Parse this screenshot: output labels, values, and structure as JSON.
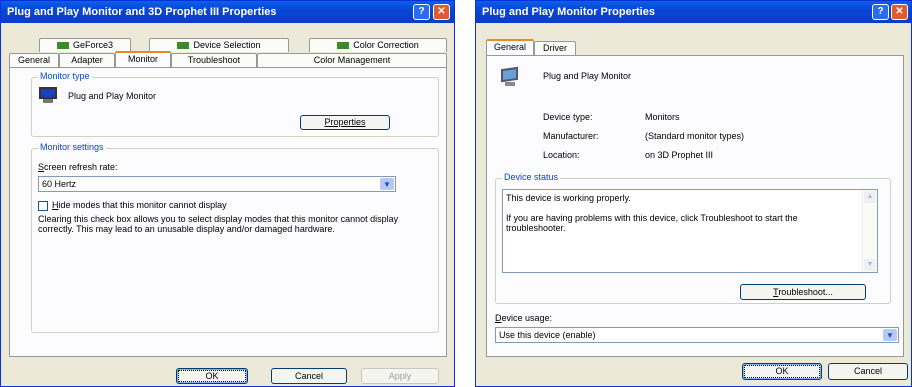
{
  "win1": {
    "title": "Plug and Play Monitor and 3D Prophet III Properties",
    "tabs_top": [
      "GeForce3",
      "Device Selection",
      "Color Correction"
    ],
    "tabs_bottom": [
      "General",
      "Adapter",
      "Monitor",
      "Troubleshoot",
      "Color Management"
    ],
    "active_tab": "Monitor",
    "monitor_type_label": "Monitor type",
    "monitor_name": "Plug and Play Monitor",
    "properties_button": "Properties",
    "monitor_settings_label": "Monitor settings",
    "refresh_label_first": "S",
    "refresh_label_rest": "creen refresh rate:",
    "refresh_value": "60 Hertz",
    "hide_modes_first": "H",
    "hide_modes_rest": "ide modes that this monitor cannot display",
    "hide_modes_checked": false,
    "description": "Clearing this check box allows you to select display modes that this monitor cannot display correctly. This may lead to an unusable display and/or damaged hardware.",
    "ok": "OK",
    "cancel": "Cancel",
    "apply": "Apply"
  },
  "win2": {
    "title": "Plug and Play Monitor Properties",
    "tabs": [
      "General",
      "Driver"
    ],
    "active_tab": "General",
    "device_name": "Plug and Play Monitor",
    "device_type_label": "Device type:",
    "device_type_value": "Monitors",
    "manufacturer_label": "Manufacturer:",
    "manufacturer_value": "(Standard monitor types)",
    "location_label": "Location:",
    "location_value": "on 3D Prophet III",
    "device_status_label": "Device status",
    "status_line1": "This device is working properly.",
    "status_line2": "If you are having problems with this device, click Troubleshoot to start the troubleshooter.",
    "troubleshoot_button_first": "T",
    "troubleshoot_button_rest": "roubleshoot...",
    "device_usage_first": "D",
    "device_usage_rest": "evice usage:",
    "device_usage_value": "Use this device (enable)",
    "ok": "OK",
    "cancel": "Cancel"
  },
  "icons": {
    "help": "?",
    "close": "✕",
    "dropdown": "▼",
    "scroll_up": "▲",
    "scroll_down": "▼"
  }
}
